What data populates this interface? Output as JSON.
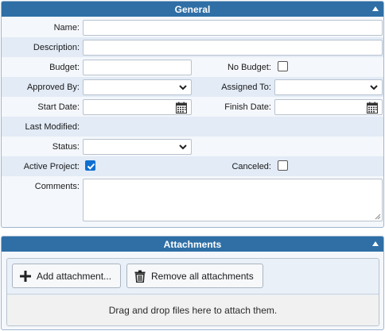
{
  "general": {
    "title": "General",
    "name_label": "Name:",
    "name_value": "",
    "description_label": "Description:",
    "description_value": "",
    "budget_label": "Budget:",
    "budget_value": "",
    "no_budget_label": "No Budget:",
    "no_budget_checked": false,
    "approved_by_label": "Approved By:",
    "approved_by_value": "",
    "assigned_to_label": "Assigned To:",
    "assigned_to_value": "",
    "start_date_label": "Start Date:",
    "start_date_value": "",
    "finish_date_label": "Finish Date:",
    "finish_date_value": "",
    "last_modified_label": "Last Modified:",
    "last_modified_value": "",
    "status_label": "Status:",
    "status_value": "",
    "active_project_label": "Active Project:",
    "active_project_checked": true,
    "canceled_label": "Canceled:",
    "canceled_checked": false,
    "comments_label": "Comments:",
    "comments_value": ""
  },
  "attachments": {
    "title": "Attachments",
    "add_label": "Add attachment...",
    "remove_all_label": "Remove all attachments",
    "dropzone_text": "Drag and drop files here to attach them."
  },
  "icons": {
    "collapse": "chevron-up-icon",
    "calendar": "calendar-icon",
    "dropdown": "chevron-down-icon",
    "add": "plus-icon",
    "remove": "trash-icon",
    "checkmark": "checkmark-icon"
  },
  "colors": {
    "header": "#2f6fa6",
    "checkbox_checked": "#0f6fd1",
    "row_alt": "#e2ebf6"
  }
}
